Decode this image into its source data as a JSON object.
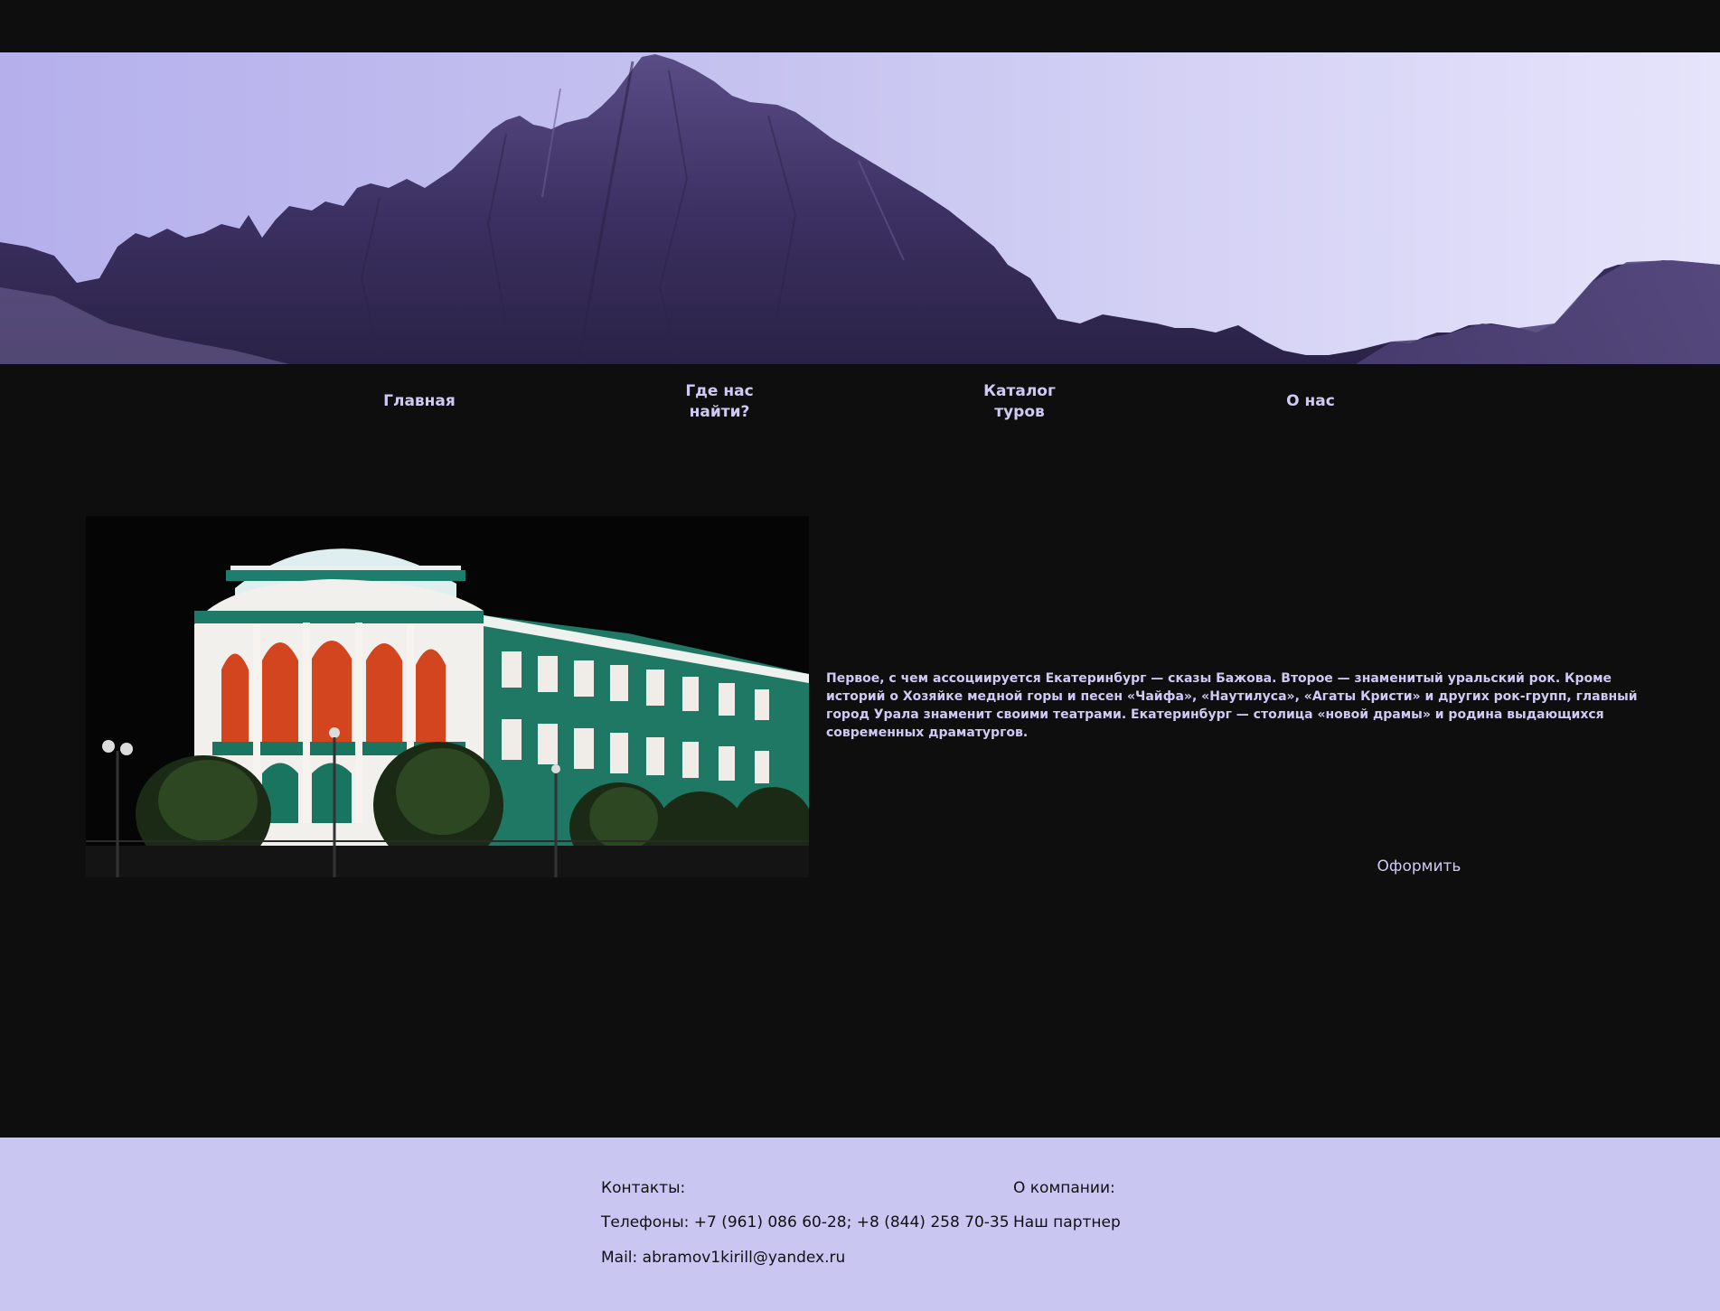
{
  "nav": {
    "items": [
      {
        "label": "Главная"
      },
      {
        "label": "Где нас\nнайти?"
      },
      {
        "label": "Каталог\nтуров"
      },
      {
        "label": "О нас"
      }
    ]
  },
  "hero": {
    "sky_color": "#c6c3f0",
    "mountain_color": "#3c3163"
  },
  "content": {
    "description": "Первое, с чем ассоциируется Екатеринбург — сказы Бажова. Второе — знаменитый уральский рок. Кроме историй о Хозяйке медной горы и песен «Чайфа», «Наутилуса», «Агаты Кристи» и других рок-групп, главный город Урала знаменит своими театрами. Екатеринбург — столица «новой драмы» и родина выдающихся современных драматургов.",
    "order_button": "Оформить"
  },
  "footer": {
    "contacts_heading": "Контакты:",
    "phones": "Телефоны: +7 (961) 086 60-28; +8 (844) 258 70-35",
    "mail": "Mail: abramov1kirill@yandex.ru",
    "about_heading": "О компании:",
    "partner": "Наш партнер"
  },
  "colors": {
    "page_bg": "#0e0e0f",
    "accent_text": "#cfcaf3",
    "footer_bg": "#c9c6f2"
  }
}
